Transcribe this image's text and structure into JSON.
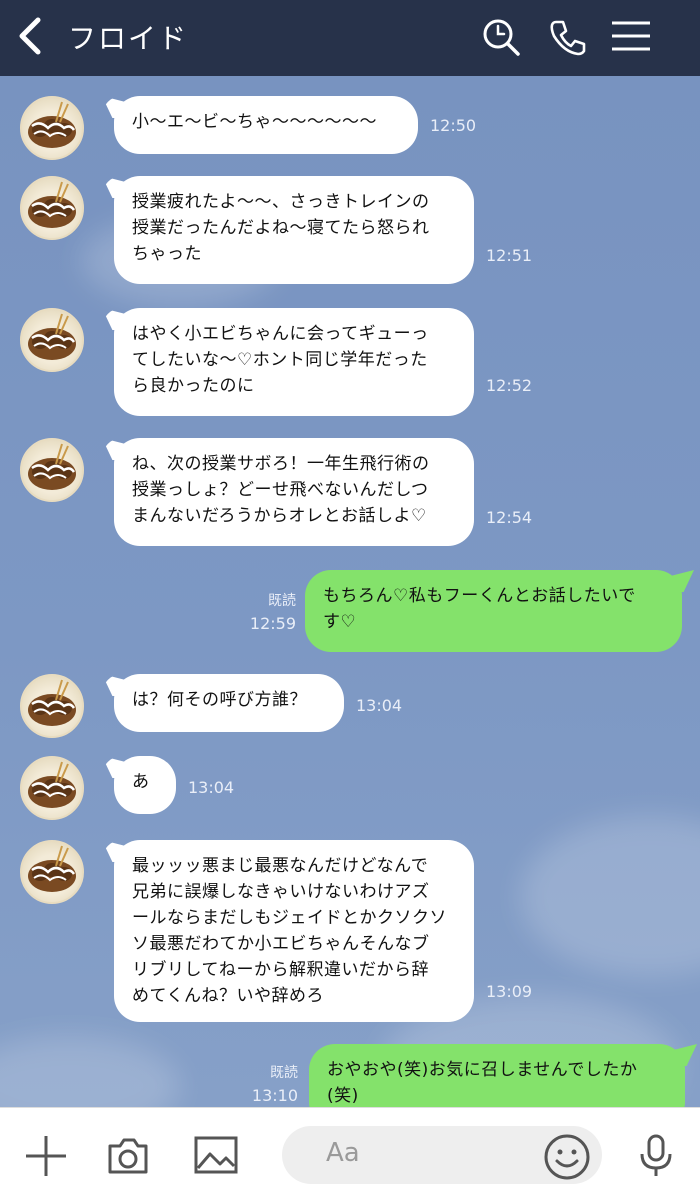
{
  "header": {
    "title": "フロイド"
  },
  "messages": [
    {
      "side": "left",
      "text": "小〜エ〜ビ〜ちゃ〜〜〜〜〜〜",
      "time": "12:50"
    },
    {
      "side": "left",
      "lines": [
        "授業疲れたよ〜〜、さっきトレインの",
        "授業だったんだよね〜寝てたら怒られ",
        "ちゃった"
      ],
      "time": "12:51"
    },
    {
      "side": "left",
      "lines": [
        "はやく小エビちゃんに会ってギューっ",
        "てしたいな〜♡ホント同じ学年だった",
        "ら良かったのに"
      ],
      "time": "12:52"
    },
    {
      "side": "left",
      "lines": [
        "ね、次の授業サボろ！一年生飛行術の",
        "授業っしょ？どーせ飛べないんだしつ",
        "まんないだろうからオレとお話しよ♡"
      ],
      "time": "12:54"
    },
    {
      "side": "right",
      "lines": [
        "もちろん♡私もフーくんとお話したいで",
        "す♡"
      ],
      "read": "既読",
      "time": "12:59"
    },
    {
      "side": "left",
      "text": "は？何その呼び方誰？",
      "time": "13:04"
    },
    {
      "side": "left",
      "text": "あ",
      "time": "13:04"
    },
    {
      "side": "left",
      "lines": [
        "最ッッッ悪まじ最悪なんだけどなんで",
        "兄弟に誤爆しなきゃいけないわけアズ",
        "ールならまだしもジェイドとかクソクソ",
        "ソ最悪だわてか小エビちゃんそんなブ",
        "リブリしてねーから解釈違いだから辞",
        "めてくんね？いや辞めろ"
      ],
      "time": "13:09"
    },
    {
      "side": "right",
      "lines": [
        "おやおや(笑)お気に召しませんでしたか",
        "(笑)"
      ],
      "read": "既読",
      "time": "13:10"
    }
  ],
  "footer": {
    "input_placeholder": "Aa"
  },
  "colors": {
    "header_bg": "#27324a",
    "chat_bg": "#7b97c4",
    "my_bubble": "#84e26b",
    "their_bubble": "#ffffff"
  }
}
